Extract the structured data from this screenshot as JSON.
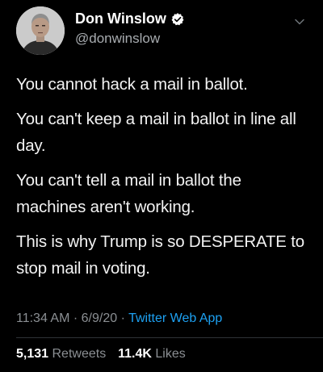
{
  "author": {
    "name": "Don Winslow",
    "handle": "@donwinslow",
    "verified": true
  },
  "tweet": {
    "paragraphs": [
      "You cannot hack a mail in ballot.",
      "You can't keep a mail in ballot in line all day.",
      "You can't tell a mail in ballot the machines aren't working.",
      "This is why Trump is so DESPERATE to stop mail in voting."
    ],
    "time": "11:34 AM",
    "date": "6/9/20",
    "separator": "·",
    "source": "Twitter Web App"
  },
  "stats": {
    "retweets_count": "5,131",
    "retweets_label": "Retweets",
    "likes_count": "11.4K",
    "likes_label": "Likes"
  },
  "colors": {
    "background": "#000000",
    "link": "#1da1f2",
    "verified_badge": "#ffffff",
    "muted": "#8b8f93"
  },
  "icons": {
    "verified": "verified-badge-icon",
    "menu": "chevron-down-icon"
  }
}
